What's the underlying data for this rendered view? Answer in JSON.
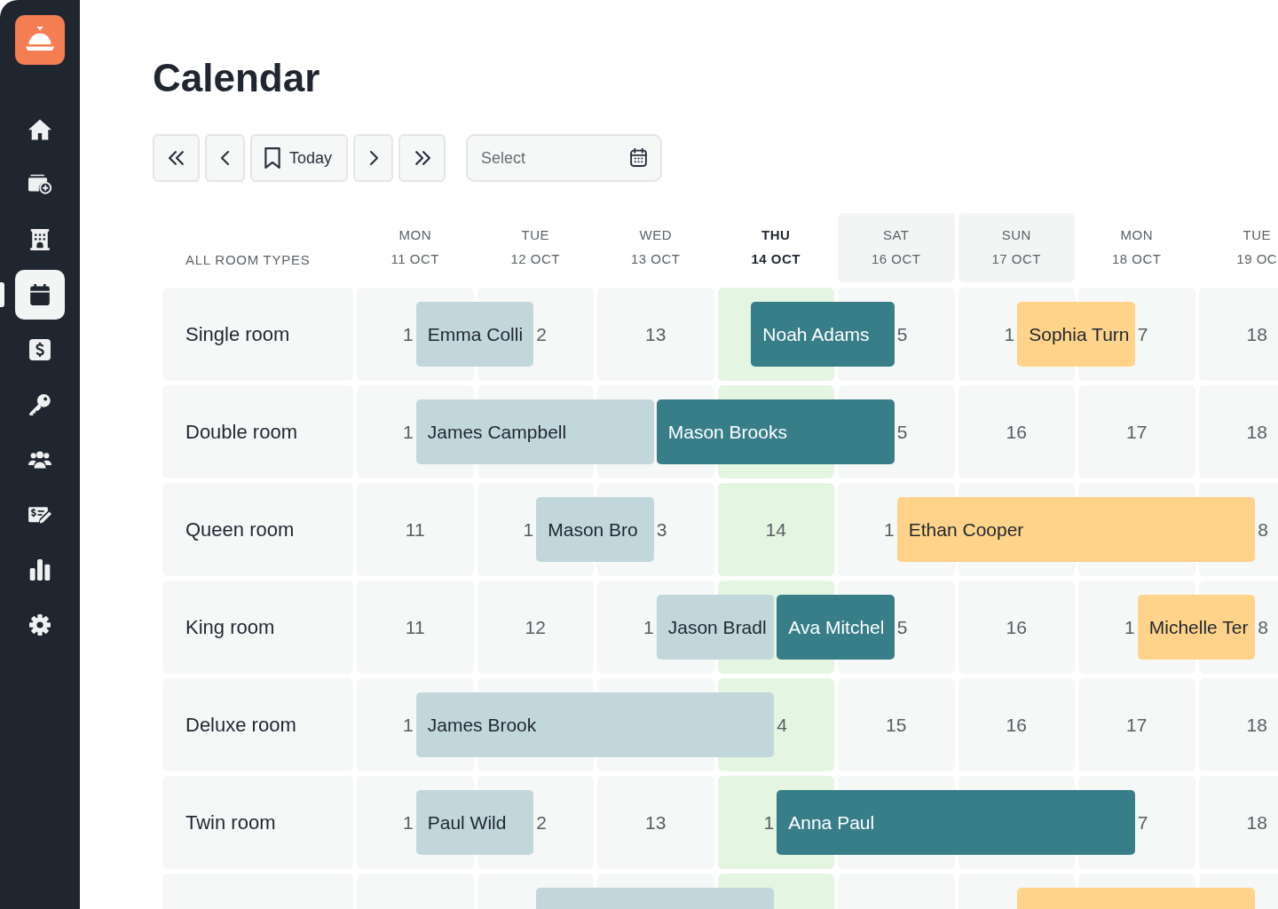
{
  "sidebar": {
    "items": [
      {
        "selected": false
      },
      {
        "selected": false
      },
      {
        "selected": false
      },
      {
        "selected": true
      },
      {
        "selected": false
      },
      {
        "selected": false
      },
      {
        "selected": false
      },
      {
        "selected": false
      },
      {
        "selected": false
      },
      {
        "selected": false
      }
    ]
  },
  "title": "Calendar",
  "toolbar": {
    "buttons": [
      {
        "kind": "first"
      },
      {
        "kind": "previous"
      },
      {
        "kind": "today",
        "label": "Today"
      },
      {
        "kind": "next"
      },
      {
        "kind": "last"
      }
    ],
    "date_picker": {
      "placeholder": "Select"
    }
  },
  "calendar": {
    "corner_label": "ALL ROOM TYPES",
    "days": [
      {
        "weekday": "MON",
        "date": "11 OCT",
        "today": false,
        "weekend": false
      },
      {
        "weekday": "TUE",
        "date": "12 OCT",
        "today": false,
        "weekend": false
      },
      {
        "weekday": "WED",
        "date": "13 OCT",
        "today": false,
        "weekend": false
      },
      {
        "weekday": "THU",
        "date": "14 OCT",
        "today": true,
        "weekend": false
      },
      {
        "weekday": "SAT",
        "date": "16 OCT",
        "today": false,
        "weekend": true
      },
      {
        "weekday": "SUN",
        "date": "17 OCT",
        "today": false,
        "weekend": true
      },
      {
        "weekday": "MON",
        "date": "18 OCT",
        "today": false,
        "weekend": false
      },
      {
        "weekday": "TUE",
        "date": "19 OC",
        "today": false,
        "weekend": false
      }
    ],
    "rows": [
      {
        "label": "Single room",
        "cells": [
          {
            "text": "1",
            "booking": {
              "name": "Emma Colli",
              "color": "#c1d7dc",
              "early": false
            }
          },
          {
            "text": "2",
            "check_out": true
          },
          {
            "text": "13"
          },
          {
            "booking": {
              "name": "Noah Adams",
              "color": "#377e89",
              "early": true
            }
          },
          {
            "text": "5",
            "check_out": true
          },
          {
            "text": "1",
            "booking": {
              "name": "Sophia Turn",
              "color": "#ffd38a",
              "early": false
            }
          },
          {
            "text": "7",
            "check_out": true
          },
          {
            "text": "18"
          }
        ]
      },
      {
        "label": "Double room",
        "cells": [
          {
            "text": "1",
            "booking": {
              "name": "James Campbell",
              "color": "#c1d7dc",
              "early": false
            }
          },
          {},
          {
            "check_out": true,
            "booking": {
              "name": "Mason Brooks",
              "color": "#377e89",
              "early": false
            }
          },
          {},
          {
            "text": "5",
            "check_out": true
          },
          {
            "text": "16"
          },
          {
            "text": "17"
          },
          {
            "text": "18"
          }
        ]
      },
      {
        "label": "Queen room",
        "cells": [
          {
            "text": "11"
          },
          {
            "text": "1",
            "booking": {
              "name": "Mason Bro",
              "color": "#c1d7dc",
              "early": false
            }
          },
          {
            "text": "3",
            "check_out": true
          },
          {
            "text": "14"
          },
          {
            "text": "1",
            "booking": {
              "name": "Ethan Cooper",
              "color": "#ffd38a",
              "early": false
            }
          },
          {},
          {},
          {
            "text": "8",
            "check_out": true
          }
        ]
      },
      {
        "label": "King room",
        "cells": [
          {
            "text": "11"
          },
          {
            "text": "12"
          },
          {
            "text": "1",
            "booking": {
              "name": "Jason Bradl",
              "color": "#c1d7dc",
              "early": false
            }
          },
          {
            "check_out": true,
            "booking": {
              "name": "Ava Mitchel",
              "color": "#377e89",
              "early": false
            }
          },
          {
            "text": "5",
            "check_out": true
          },
          {
            "text": "16"
          },
          {
            "text": "1",
            "booking": {
              "name": "Michelle Ter",
              "color": "#ffd38a",
              "early": false
            }
          },
          {
            "text": "8",
            "check_out": true
          }
        ]
      },
      {
        "label": "Deluxe room",
        "cells": [
          {
            "text": "1",
            "booking": {
              "name": "James Brook",
              "color": "#c1d7dc",
              "early": false
            }
          },
          {},
          {},
          {
            "text": "4",
            "check_out": true
          },
          {
            "text": "15"
          },
          {
            "text": "16"
          },
          {
            "text": "17"
          },
          {
            "text": "18"
          }
        ]
      },
      {
        "label": "Twin room",
        "cells": [
          {
            "text": "1",
            "booking": {
              "name": "Paul Wild",
              "color": "#c1d7dc",
              "early": false
            }
          },
          {
            "text": "2",
            "check_out": true
          },
          {
            "text": "13"
          },
          {
            "text": "1",
            "booking": {
              "name": "Anna Paul",
              "color": "#377e89",
              "early": false
            }
          },
          {},
          {},
          {
            "text": "7",
            "check_out": true
          },
          {
            "text": "18"
          }
        ]
      },
      {
        "cells": [
          {},
          {
            "booking": {
              "color": "#c1d7dc",
              "early": false
            }
          },
          {},
          {
            "check_out": true
          },
          {},
          {
            "booking": {
              "color": "#ffd38a",
              "early": false
            }
          },
          {},
          {
            "check_out": true
          }
        ]
      }
    ]
  }
}
